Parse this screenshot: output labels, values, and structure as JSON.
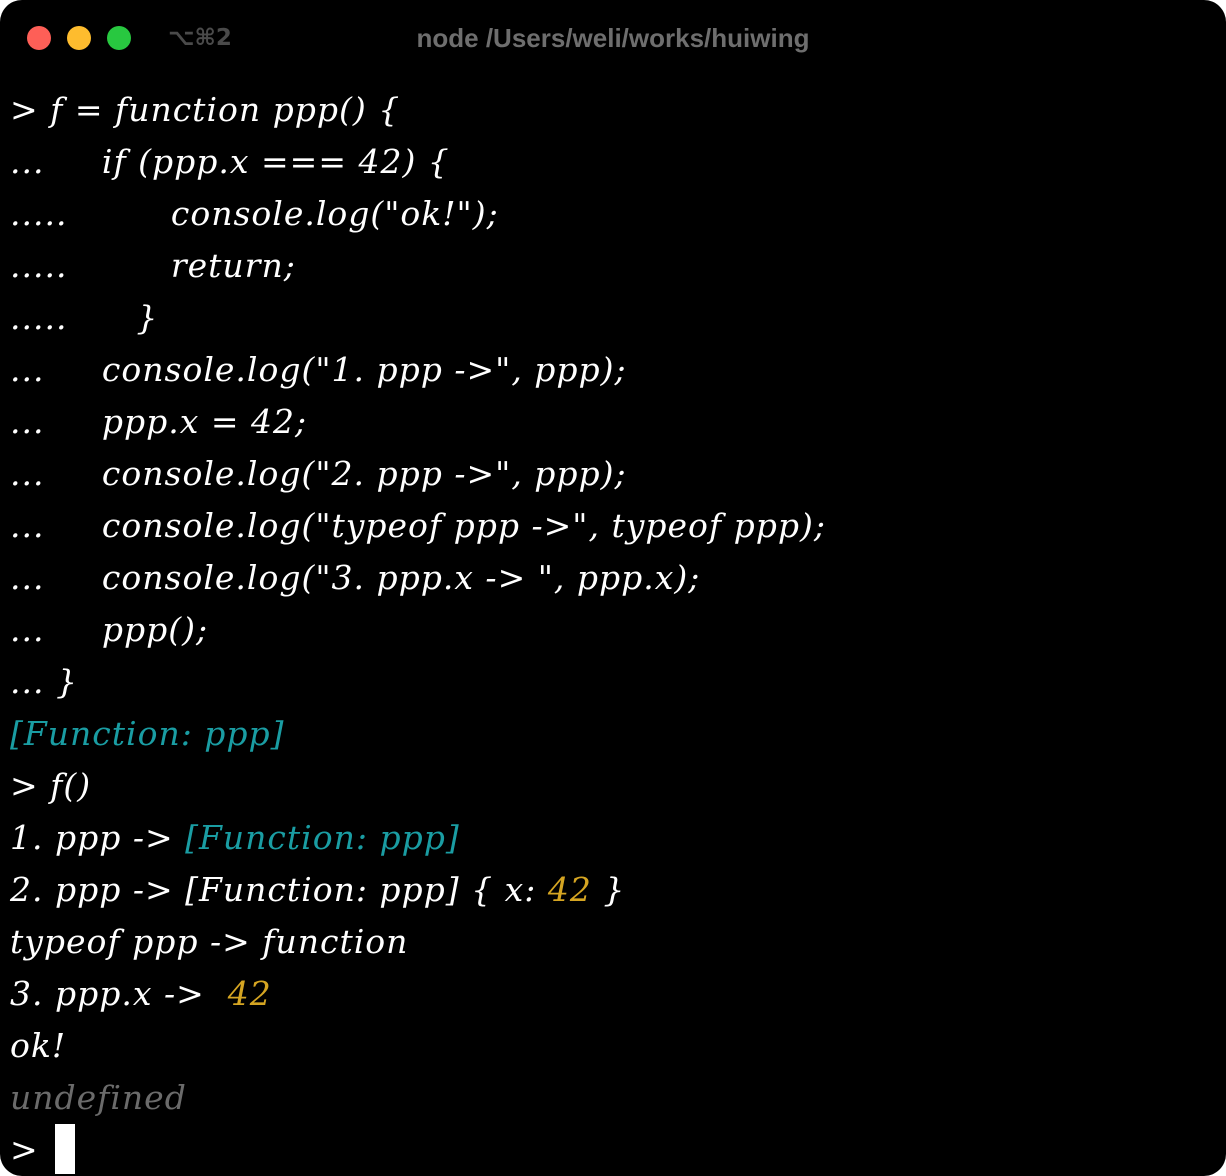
{
  "window": {
    "shortcut": "⌥⌘2",
    "title": "node /Users/weli/works/huiwing"
  },
  "lines": [
    [
      {
        "text": "> f = function ppp() {",
        "color": "white"
      }
    ],
    [
      {
        "text": "...     if (ppp.x === 42) {",
        "color": "white"
      }
    ],
    [
      {
        "text": ".....         console.log(\"ok!\");",
        "color": "white"
      }
    ],
    [
      {
        "text": ".....         return;",
        "color": "white"
      }
    ],
    [
      {
        "text": ".....      }",
        "color": "white"
      }
    ],
    [
      {
        "text": "...     console.log(\"1. ppp ->\", ppp);",
        "color": "white"
      }
    ],
    [
      {
        "text": "...     ppp.x = 42;",
        "color": "white"
      }
    ],
    [
      {
        "text": "...     console.log(\"2. ppp ->\", ppp);",
        "color": "white"
      }
    ],
    [
      {
        "text": "...     console.log(\"typeof ppp ->\", typeof ppp);",
        "color": "white"
      }
    ],
    [
      {
        "text": "...     console.log(\"3. ppp.x -> \", ppp.x);",
        "color": "white"
      }
    ],
    [
      {
        "text": "...     ppp();",
        "color": "white"
      }
    ],
    [
      {
        "text": "... }",
        "color": "white"
      }
    ],
    [
      {
        "text": "[Function: ppp]",
        "color": "cyan"
      }
    ],
    [
      {
        "text": "> f()",
        "color": "white"
      }
    ],
    [
      {
        "text": "1. ppp -> ",
        "color": "white"
      },
      {
        "text": "[Function: ppp]",
        "color": "cyan"
      }
    ],
    [
      {
        "text": "2. ppp -> [Function: ppp] { x: ",
        "color": "white"
      },
      {
        "text": "42",
        "color": "yellow"
      },
      {
        "text": " }",
        "color": "white"
      }
    ],
    [
      {
        "text": "typeof ppp -> function",
        "color": "white"
      }
    ],
    [
      {
        "text": "3. ppp.x ->  ",
        "color": "white"
      },
      {
        "text": "42",
        "color": "yellow"
      }
    ],
    [
      {
        "text": "ok!",
        "color": "white"
      }
    ],
    [
      {
        "text": "undefined",
        "color": "gray"
      }
    ]
  ],
  "prompt": {
    "symbol": ">"
  }
}
